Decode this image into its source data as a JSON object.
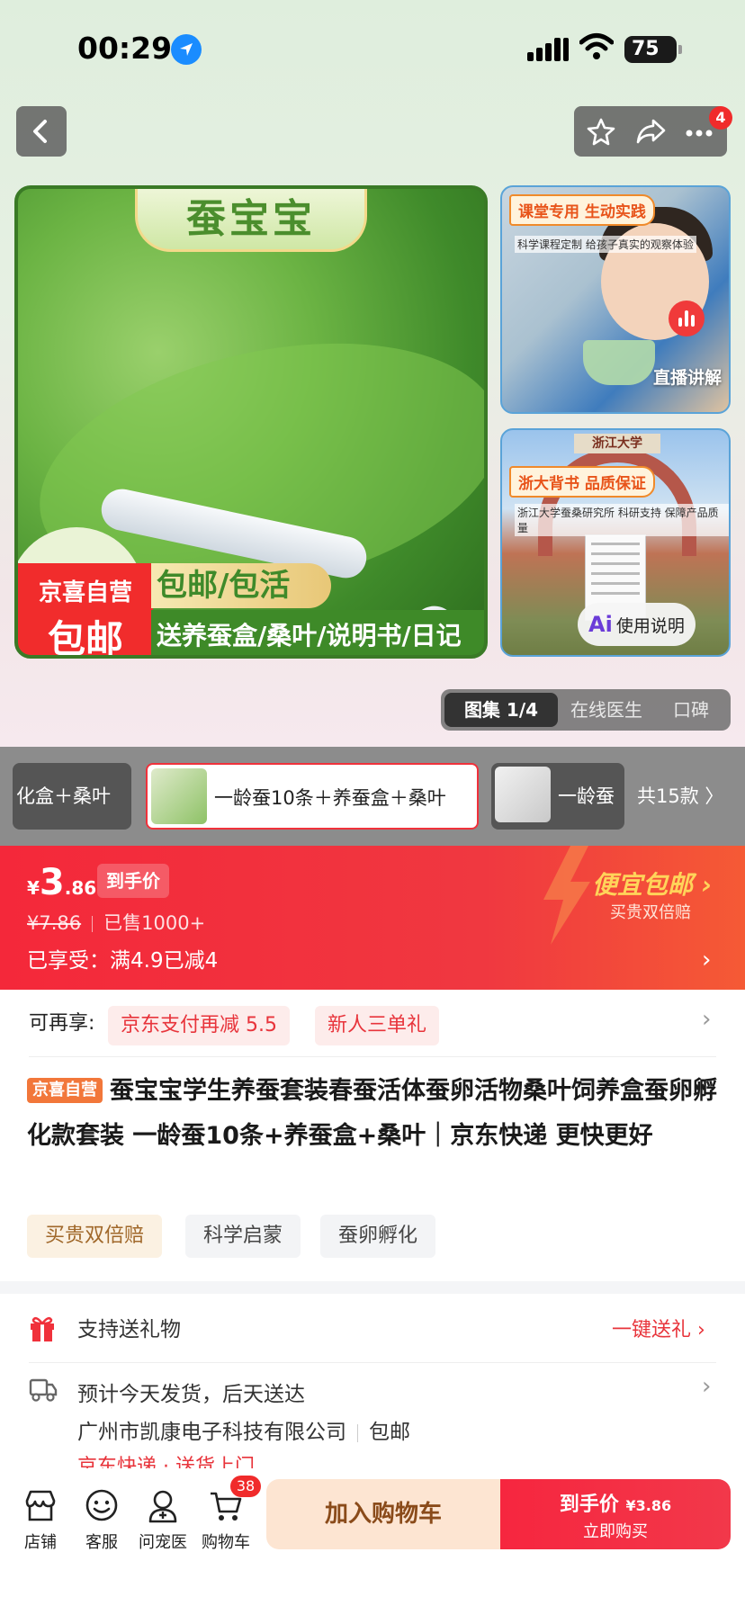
{
  "status_bar": {
    "time": "00:29",
    "battery": "75"
  },
  "nav": {
    "more_badge": "4"
  },
  "main_image": {
    "title": "蚕宝宝",
    "promo_brand": "京喜自营",
    "promo_free": "包邮",
    "promo_tag": "包邮/包活",
    "promo_gift": "送养蚕盒/桑叶/说明书/日记"
  },
  "side_images": [
    {
      "tag": "课堂专用 生动实践",
      "sub": "科学课程定制 给孩子真实的观察体验",
      "caption": "直播讲解"
    },
    {
      "tag": "浙大背书 品质保证",
      "sub": "浙江大学蚕桑研究所 科研支持 保障产品质量",
      "sign": "浙江大学",
      "caption": "使用说明"
    }
  ],
  "gallery": {
    "current": "图集 1/4",
    "doctor": "在线医生",
    "reviews": "口碑"
  },
  "sku": {
    "items": [
      "化盒＋桑叶",
      "一龄蚕10条＋养蚕盒＋桑叶",
      "一龄蚕"
    ],
    "total": "共15款 〉"
  },
  "price": {
    "currency": "¥",
    "integer": "3",
    "decimal": ".86",
    "label": "到手价",
    "original": "¥7.86",
    "sold": "已售1000+",
    "enjoyed": "已享受：满4.9已减4",
    "cheap_title": "便宜包邮 ›",
    "cheap_sub": "买贵双倍赔"
  },
  "extra": {
    "label": "可再享:",
    "coupons": [
      "京东支付再减 5.5",
      "新人三单礼"
    ]
  },
  "product": {
    "self_tag": "京喜自营",
    "title": "蚕宝宝学生养蚕套装春蚕活体蚕卵活物桑叶饲养盒蚕卵孵化款套装 一龄蚕10条+养蚕盒+桑叶｜京东快递 更快更好",
    "chips": [
      "买贵双倍赔",
      "科学启蒙",
      "蚕卵孵化"
    ]
  },
  "gift": {
    "label": "支持送礼物",
    "link": "一键送礼 ›"
  },
  "shipping": {
    "line1": "预计今天发货，后天送达",
    "seller": "广州市凯康电子科技有限公司",
    "free": "包邮",
    "express": "京东快递 · 送货上门"
  },
  "bottom_bar": {
    "tabs": [
      "店铺",
      "客服",
      "问宠医",
      "购物车"
    ],
    "cart_count": "38",
    "add_cart": "加入购物车",
    "buy_label": "到手价",
    "buy_price": "¥3.86",
    "buy_sub": "立即购买"
  },
  "colors": {
    "accent": "#f0313b",
    "gold": "#ffd45a",
    "green": "#3e8a28"
  }
}
